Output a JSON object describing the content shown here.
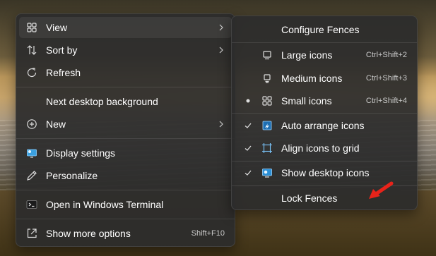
{
  "main_menu": {
    "items": [
      {
        "label": "View",
        "icon": "grid-icon",
        "submenu": true
      },
      {
        "label": "Sort by",
        "icon": "sort-icon",
        "submenu": true
      },
      {
        "label": "Refresh",
        "icon": "refresh-icon"
      },
      {
        "label": "Next desktop background"
      },
      {
        "label": "New",
        "icon": "plus-circle-icon",
        "submenu": true
      },
      {
        "label": "Display settings",
        "icon": "display-icon"
      },
      {
        "label": "Personalize",
        "icon": "pen-icon"
      },
      {
        "label": "Open in Windows Terminal",
        "icon": "terminal-icon"
      },
      {
        "label": "Show more options",
        "icon": "share-icon",
        "shortcut": "Shift+F10"
      }
    ]
  },
  "sub_menu": {
    "items": [
      {
        "label": "Configure Fences"
      },
      {
        "label": "Large icons",
        "icon": "monitor-icon",
        "shortcut": "Ctrl+Shift+2"
      },
      {
        "label": "Medium icons",
        "icon": "monitor-small-icon",
        "shortcut": "Ctrl+Shift+3"
      },
      {
        "label": "Small icons",
        "icon": "grid-icon",
        "shortcut": "Ctrl+Shift+4",
        "mark": "bullet"
      },
      {
        "label": "Auto arrange icons",
        "icon": "auto-arrange-icon",
        "mark": "check"
      },
      {
        "label": "Align icons to grid",
        "icon": "align-grid-icon",
        "mark": "check"
      },
      {
        "label": "Show desktop icons",
        "icon": "desktop-icon",
        "mark": "check"
      },
      {
        "label": "Lock Fences"
      }
    ]
  },
  "colors": {
    "menu_bg": "#2c2c2c",
    "accent": "#4cc2ff",
    "annotation_arrow": "#e8231a"
  }
}
